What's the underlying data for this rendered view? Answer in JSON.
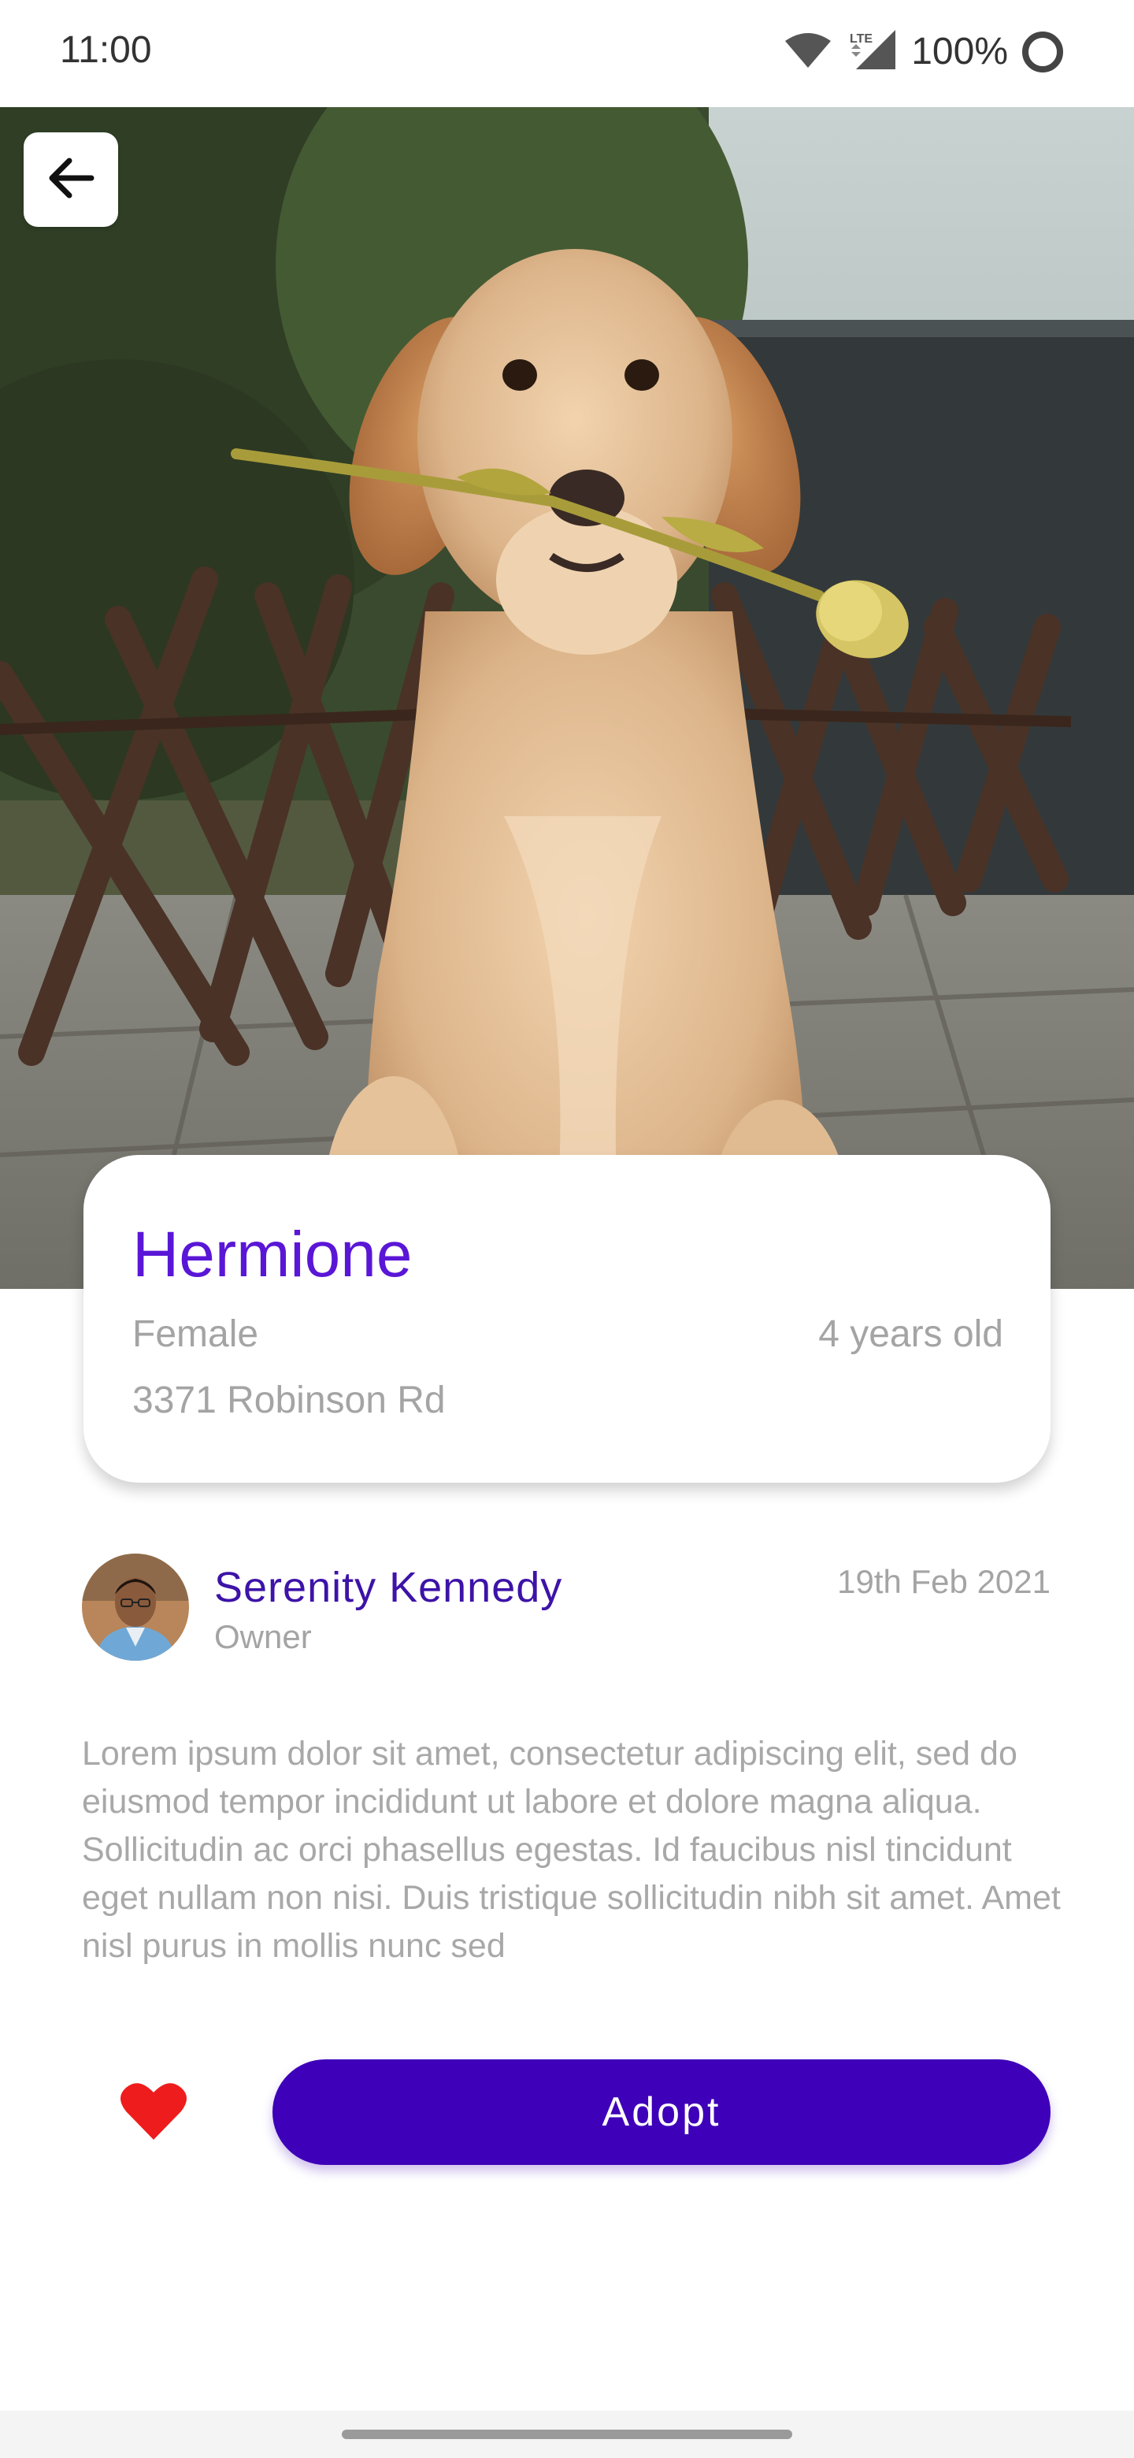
{
  "status_bar": {
    "time": "11:00",
    "battery": "100%",
    "network": "LTE",
    "icons": [
      "wifi-icon",
      "cellular-signal-icon",
      "battery-icon"
    ]
  },
  "header": {
    "back_icon": "arrow-left-icon"
  },
  "pet": {
    "name": "Hermione",
    "gender": "Female",
    "age": "4 years old",
    "address": "3371 Robinson Rd"
  },
  "owner": {
    "name": "Serenity Kennedy",
    "role": "Owner",
    "date": "19th Feb 2021"
  },
  "description": "Lorem ipsum dolor sit amet, consectetur adipiscing elit, sed do eiusmod tempor incididunt ut labore et dolore magna aliqua. Sollicitudin ac orci phasellus egestas. Id faucibus nisl tincidunt eget nullam non nisi. Duis tristique sollicitudin nibh sit amet. Amet nisl purus in mollis nunc sed",
  "actions": {
    "like_icon": "heart-icon",
    "adopt_label": "Adopt"
  },
  "colors": {
    "accent": "#3e00b8",
    "pet_name": "#5a16d6",
    "owner_name": "#3d13a8",
    "heart": "#ee1c1c",
    "muted_text": "#a4a4a4"
  }
}
